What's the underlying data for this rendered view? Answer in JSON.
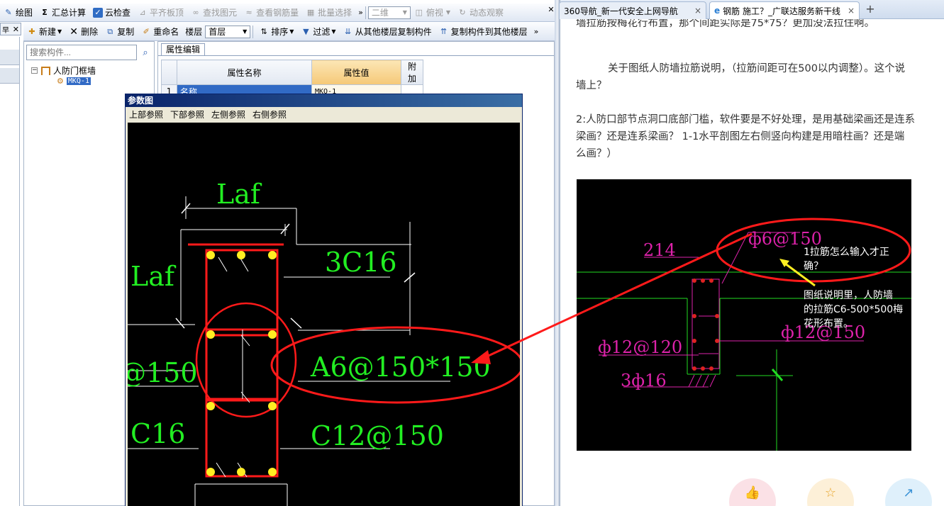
{
  "cad_app": {
    "toolbar1": {
      "draw": "绘图",
      "sum_calc": "汇总计算",
      "cloud_check": "云检查",
      "level_slab_top": "平齐板顶",
      "find_element": "查找图元",
      "view_rebar": "查看钢筋量",
      "batch_select": "批量选择",
      "view_mode": "二维",
      "top_view": "俯视",
      "dynamic_view": "动态观察",
      "more": "»"
    },
    "toolbar2": {
      "close_glyph": "✕",
      "new": "新建",
      "delete": "删除",
      "copy": "复制",
      "rename": "重命名",
      "floor_label": "楼层",
      "floor_value": "首层",
      "sort": "排序",
      "filter": "过滤",
      "copy_from_other_floor": "从其他楼层复制构件",
      "copy_to_other_floor": "复制构件到其他楼层",
      "more": "»"
    },
    "tree": {
      "search_placeholder": "搜索构件...",
      "root_label": "人防门框墙",
      "child_label": "MKQ-1",
      "toggle": "⊟"
    },
    "properties": {
      "tab_label": "属性编辑",
      "col_name": "属性名称",
      "col_value": "属性值",
      "col_extra": "附加",
      "rows": [
        {
          "num": "1",
          "name": "名称",
          "value": "MKQ-1"
        }
      ]
    },
    "param_dialog": {
      "title": "参数图",
      "menu": [
        "上部参照",
        "下部参照",
        "左侧参照",
        "右侧参照"
      ],
      "labels": {
        "laf_top": "Laf",
        "laf_left": "Laf",
        "rebar_3c16": "3C16",
        "left_150": "@150",
        "stirrup": "A6@150*150",
        "left_c16": "C16",
        "c12_150": "C12@150"
      }
    }
  },
  "browser": {
    "tabs": [
      {
        "label": "360导航_新一代安全上网导航",
        "close": "×"
      },
      {
        "label": "钢筋 施工？_广联达服务新干线",
        "close": "×"
      }
    ],
    "new_tab": "+",
    "article": {
      "line_top": "墙拉筋按梅花行布置，那个间距实际是75*75？更加没法拉住啊。",
      "para1_line1": "关于图纸人防墙拉筋说明，（拉筋间距可在500以内调整）。这个说",
      "para1_line2": "墙上？",
      "para2_line1": "2:人防口部节点洞口底部门槛，软件要是不好处理，是用基础梁画还是连系",
      "para2_line2": "梁画？还是连系梁画？   1-1水平剖图左右侧竖向构建是用暗柱画？还是端",
      "para2_line3": "么画？）"
    },
    "cad_image": {
      "label_214": "214",
      "label_phi6": "ф6@150",
      "label_phi12_left": "ф12@120",
      "label_phi12_right": "ф12@150",
      "label_3phi16": "3ф16",
      "note1_line1": "1拉筋怎么输入才正",
      "note1_line2": "确？",
      "note2_line1": "图纸说明里，人防墙",
      "note2_line2": "的拉筋C6-500*500梅",
      "note2_line3": "花形布置。"
    },
    "actions": {
      "like_icon": "👍",
      "star_icon": "☆",
      "share_icon": "↗"
    }
  }
}
